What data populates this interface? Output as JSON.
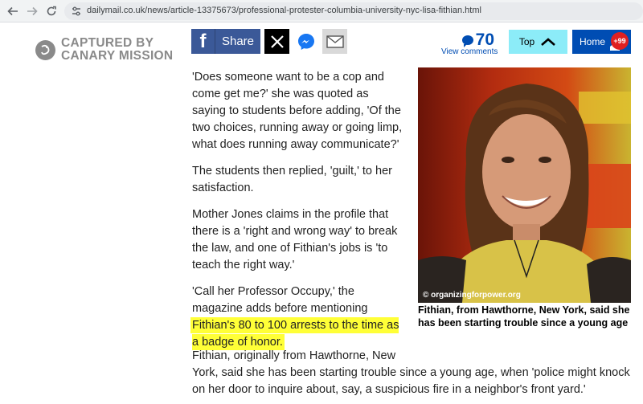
{
  "browser": {
    "url": "dailymail.co.uk/news/article-13375673/professional-protester-columbia-university-nyc-lisa-fithian.html",
    "back_icon": "arrow-left-icon",
    "forward_icon": "arrow-right-icon",
    "reload_icon": "reload-icon"
  },
  "watermark": {
    "line1": "CAPTURED BY",
    "line2": "CANARY MISSION"
  },
  "share": {
    "facebook_label": "Share"
  },
  "comments": {
    "count": "70",
    "label": "View comments"
  },
  "nav": {
    "top_label": "Top",
    "home_label": "Home",
    "home_badge": "+99"
  },
  "article": {
    "p1": "'Does someone want to be a cop and come get me?' she was quoted as saying to students before adding, 'Of the two choices, running away or going limp, what does running away communicate?'",
    "p2": "The students then replied, 'guilt,' to her satisfaction.",
    "p3": "Mother Jones claims in the profile that there is a 'right and wrong way' to break the law, and one of Fithian's jobs is 'to teach the right way.'",
    "p4_plain": "'Call her Professor Occupy,' the magazine adds before mentioning ",
    "p4_highlight": "Fithian's 80 to 100 arrests to the time as a badge of honor.",
    "p5_line1": "Fithian, originally from Hawthorne, New",
    "p5_rest": "York, said she has been starting trouble since a young age, when 'police might knock on her door to inquire about, say, a suspicious fire in a neighbor's front yard.'"
  },
  "photo": {
    "credit": "© organizingforpower.org",
    "caption": "Fithian, from Hawthorne, New York,  said she has been starting trouble since a young age"
  },
  "colors": {
    "highlight": "#ffff37",
    "facebook": "#3b5998",
    "dm_blue": "#004db3",
    "top_button": "#8cecf8",
    "badge_red": "#e02020"
  }
}
